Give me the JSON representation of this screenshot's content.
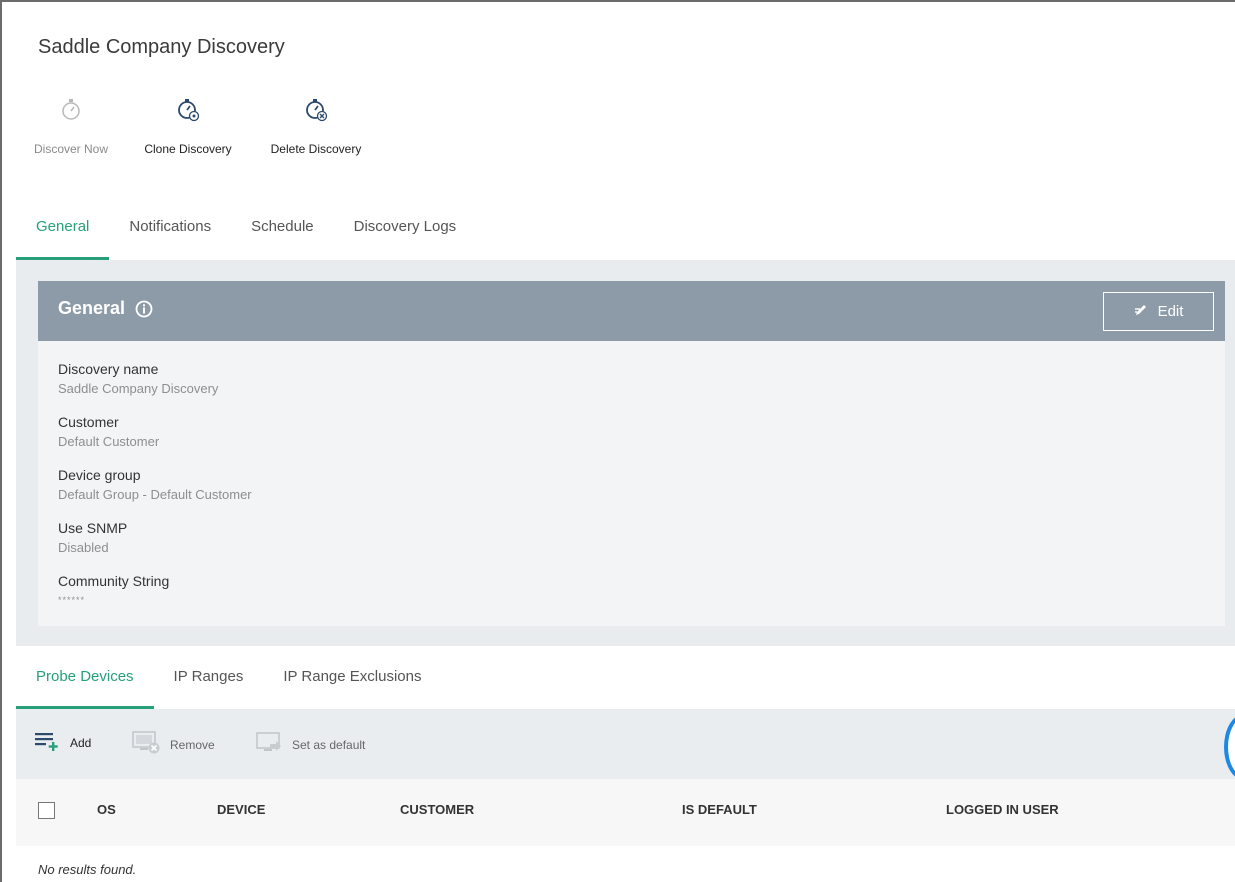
{
  "page": {
    "title": "Saddle Company Discovery"
  },
  "toolbar": {
    "discover_now": "Discover Now",
    "clone_discovery": "Clone Discovery",
    "delete_discovery": "Delete Discovery"
  },
  "tabs_top": [
    "General",
    "Notifications",
    "Schedule",
    "Discovery Logs"
  ],
  "general": {
    "title": "General",
    "edit_label": "Edit",
    "fields": [
      {
        "label": "Discovery name",
        "value": "Saddle Company Discovery"
      },
      {
        "label": "Customer",
        "value": "Default Customer"
      },
      {
        "label": "Device group",
        "value": "Default Group - Default Customer"
      },
      {
        "label": "Use SNMP",
        "value": "Disabled"
      },
      {
        "label": "Community String",
        "value": "******"
      }
    ]
  },
  "tabs_bottom": [
    "Probe Devices",
    "IP Ranges",
    "IP Range Exclusions"
  ],
  "actions": {
    "add": "Add",
    "remove": "Remove",
    "set_default": "Set as default"
  },
  "table": {
    "columns": [
      "OS",
      "DEVICE",
      "CUSTOMER",
      "IS DEFAULT",
      "LOGGED IN USER"
    ],
    "empty_text": "No results found."
  },
  "colors": {
    "accent": "#27a07a",
    "card_header": "#8d9ba8",
    "icon_blue": "#2c4a6e"
  },
  "icons": [
    "stopwatch-icon",
    "clone-discovery-icon",
    "delete-discovery-icon",
    "info-icon",
    "edit-icon",
    "add-list-icon",
    "remove-icon",
    "set-default-icon"
  ]
}
